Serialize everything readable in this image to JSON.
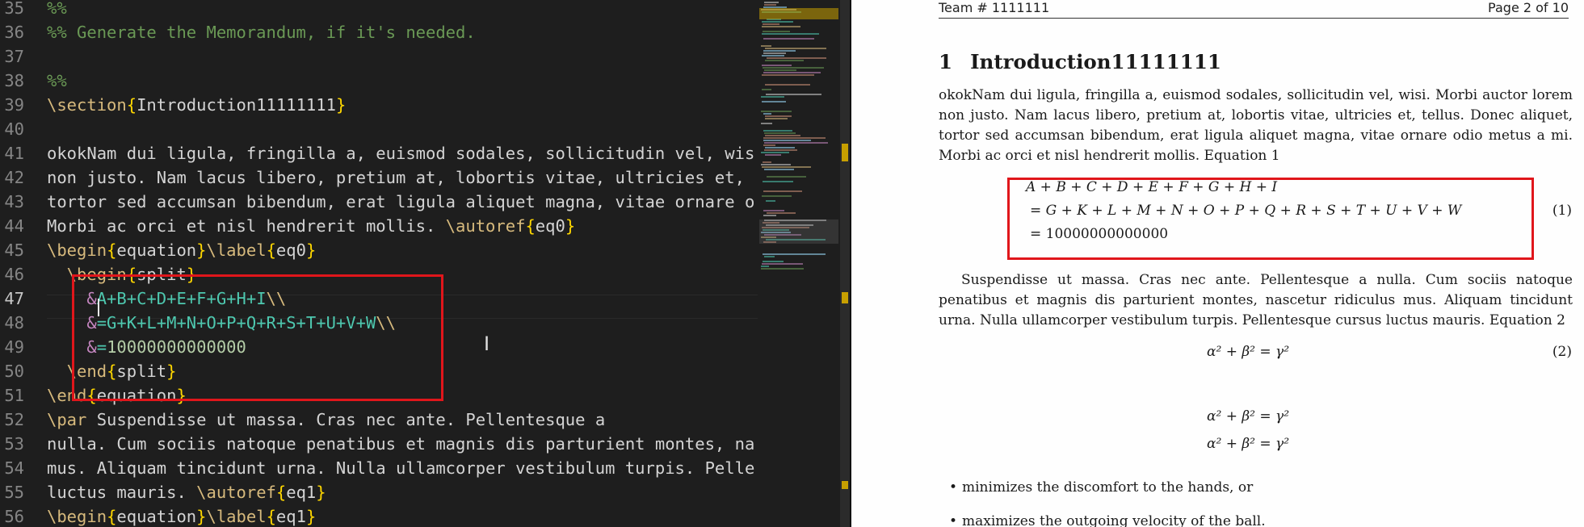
{
  "editor": {
    "lines": [
      {
        "n": "35",
        "parts": [
          [
            "%%",
            "c-com"
          ]
        ]
      },
      {
        "n": "36",
        "parts": [
          [
            "%% Generate the Memorandum, if it's needed.",
            "c-com"
          ]
        ]
      },
      {
        "n": "37",
        "parts": []
      },
      {
        "n": "38",
        "parts": [
          [
            "%%",
            "c-com"
          ]
        ]
      },
      {
        "n": "39",
        "parts": [
          [
            "\\section",
            "c-cmd"
          ],
          [
            "{",
            "c-brace"
          ],
          [
            "Introduction11111111",
            "c-arg"
          ],
          [
            "}",
            "c-brace"
          ]
        ]
      },
      {
        "n": "40",
        "parts": []
      },
      {
        "n": "41",
        "parts": [
          [
            "okokNam dui ligula, fringilla a, euismod sodales, sollicitudin vel, wis",
            "c-txt"
          ]
        ]
      },
      {
        "n": "42",
        "parts": [
          [
            "non justo. Nam lacus libero, pretium at, lobortis vitae, ultricies et, ",
            "c-txt"
          ]
        ]
      },
      {
        "n": "43",
        "parts": [
          [
            "tortor sed accumsan bibendum, erat ligula aliquet magna, vitae ornare o",
            "c-txt"
          ]
        ]
      },
      {
        "n": "44",
        "parts": [
          [
            "Morbi ac orci et nisl hendrerit mollis. ",
            "c-txt"
          ],
          [
            "\\autoref",
            "c-cmd"
          ],
          [
            "{",
            "c-brace"
          ],
          [
            "eq0",
            "c-arg"
          ],
          [
            "}",
            "c-brace"
          ]
        ]
      },
      {
        "n": "45",
        "parts": [
          [
            "\\begin",
            "c-cmd"
          ],
          [
            "{",
            "c-brace"
          ],
          [
            "equation",
            "c-arg"
          ],
          [
            "}",
            "c-brace"
          ],
          [
            "\\label",
            "c-cmd"
          ],
          [
            "{",
            "c-brace"
          ],
          [
            "eq0",
            "c-arg"
          ],
          [
            "}",
            "c-brace"
          ]
        ]
      },
      {
        "n": "46",
        "parts": [
          [
            "  \\begin",
            "c-cmd"
          ],
          [
            "{",
            "c-brace"
          ],
          [
            "split",
            "c-arg"
          ],
          [
            "}",
            "c-brace"
          ]
        ]
      },
      {
        "n": "47",
        "parts": [
          [
            "    &",
            "c-amp"
          ],
          [
            "A+B+C+D+E+F+G+H+I",
            "c-math"
          ],
          [
            "\\\\",
            "c-bs"
          ]
        ],
        "active": true
      },
      {
        "n": "48",
        "parts": [
          [
            "    &",
            "c-amp"
          ],
          [
            "=G+K+L+M+N+O+P+Q+R+S+T+U+V+W",
            "c-math"
          ],
          [
            "\\\\",
            "c-bs"
          ]
        ]
      },
      {
        "n": "49",
        "parts": [
          [
            "    &",
            "c-amp"
          ],
          [
            "=",
            "c-math"
          ],
          [
            "10000000000000",
            "c-num"
          ]
        ]
      },
      {
        "n": "50",
        "parts": [
          [
            "  \\end",
            "c-cmd"
          ],
          [
            "{",
            "c-brace"
          ],
          [
            "split",
            "c-arg"
          ],
          [
            "}",
            "c-brace"
          ]
        ]
      },
      {
        "n": "51",
        "parts": [
          [
            "\\end",
            "c-cmd"
          ],
          [
            "{",
            "c-brace"
          ],
          [
            "equation",
            "c-arg"
          ],
          [
            "}",
            "c-brace"
          ]
        ]
      },
      {
        "n": "52",
        "parts": [
          [
            "\\par",
            "c-cmd"
          ],
          [
            " Suspendisse ut massa. Cras nec ante. Pellentesque a",
            "c-txt"
          ]
        ]
      },
      {
        "n": "53",
        "parts": [
          [
            "nulla. Cum sociis natoque penatibus et magnis dis parturient montes, na",
            "c-txt"
          ]
        ]
      },
      {
        "n": "54",
        "parts": [
          [
            "mus. Aliquam tincidunt urna. Nulla ullamcorper vestibulum turpis. Pelle",
            "c-txt"
          ]
        ]
      },
      {
        "n": "55",
        "parts": [
          [
            "luctus mauris. ",
            "c-txt"
          ],
          [
            "\\autoref",
            "c-cmd"
          ],
          [
            "{",
            "c-brace"
          ],
          [
            "eq1",
            "c-arg"
          ],
          [
            "}",
            "c-brace"
          ]
        ]
      },
      {
        "n": "56",
        "parts": [
          [
            "\\begin",
            "c-cmd"
          ],
          [
            "{",
            "c-brace"
          ],
          [
            "equation",
            "c-arg"
          ],
          [
            "}",
            "c-brace"
          ],
          [
            "\\label",
            "c-cmd"
          ],
          [
            "{",
            "c-brace"
          ],
          [
            "eq1",
            "c-arg"
          ],
          [
            "}",
            "c-brace"
          ]
        ]
      }
    ]
  },
  "pdf": {
    "header_left": "Team # 1111111",
    "header_right": "Page 2 of 10",
    "section_number": "1",
    "section_title": "Introduction11111111",
    "para1": "okokNam dui ligula, fringilla a, euismod sodales, sollicitudin vel, wisi. Morbi auctor lorem non justo. Nam lacus libero, pretium at, lobortis vitae, ultricies et, tellus. Donec aliquet, tortor sed accumsan bibendum, erat ligula aliquet magna, vitae ornare odio metus a mi. Morbi ac orci et nisl hendrerit mollis. Equation 1",
    "eq1_line1": "A + B + C + D + E + F + G + H + I",
    "eq1_line2": "= G + K + L + M + N + O + P + Q + R + S + T + U + V + W",
    "eq1_line3": "= 10000000000000",
    "eq1_number": "(1)",
    "para2": "Suspendisse ut massa. Cras nec ante. Pellentesque a nulla. Cum sociis natoque penatibus et magnis dis parturient montes, nascetur ridiculus mus. Aliquam tincidunt urna. Nulla ullamcorper vestibulum turpis. Pellentesque cursus luctus mauris. Equation 2",
    "eq2": "α² + β² = γ²",
    "eq2_number": "(2)",
    "eq3a": "α² + β² = γ²",
    "eq3b": "α² + β² = γ²",
    "bullets": [
      "minimizes the discomfort to the hands, or",
      "maximizes the outgoing velocity of the ball."
    ]
  },
  "colors": {
    "highlight_box": "#e0161b",
    "editor_bg": "#1e1e1e"
  }
}
